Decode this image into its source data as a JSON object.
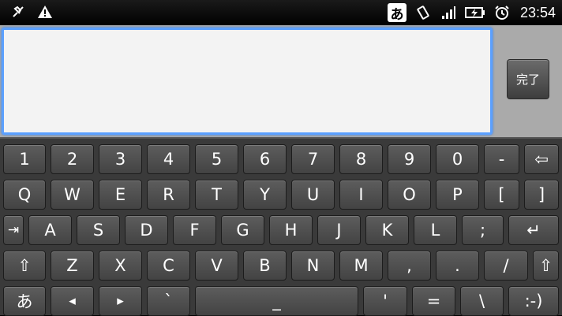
{
  "statusbar": {
    "left_icons": [
      "usb-debug-icon",
      "warning-icon"
    ],
    "ime_indicator": "あ",
    "right_icons": [
      "vibrate-icon",
      "signal-icon",
      "battery-charging-icon",
      "alarm-icon"
    ],
    "time": "23:54"
  },
  "editor": {
    "text_value": "",
    "done_label": "完了"
  },
  "keyboard": {
    "row1": [
      "1",
      "2",
      "3",
      "4",
      "5",
      "6",
      "7",
      "8",
      "9",
      "0",
      "-",
      "⇦"
    ],
    "row2": [
      "Q",
      "W",
      "E",
      "R",
      "T",
      "Y",
      "U",
      "I",
      "O",
      "P",
      "[",
      "]"
    ],
    "row3": [
      "⇥",
      "A",
      "S",
      "D",
      "F",
      "G",
      "H",
      "J",
      "K",
      "L",
      ";",
      "↵"
    ],
    "row4": [
      "⇧",
      "Z",
      "X",
      "C",
      "V",
      "B",
      "N",
      "M",
      ",",
      ".",
      "/",
      "⇧"
    ],
    "row5": [
      "あ",
      "◂",
      "▸",
      "`",
      "_",
      "'",
      "=",
      "\\",
      ":-)"
    ]
  }
}
